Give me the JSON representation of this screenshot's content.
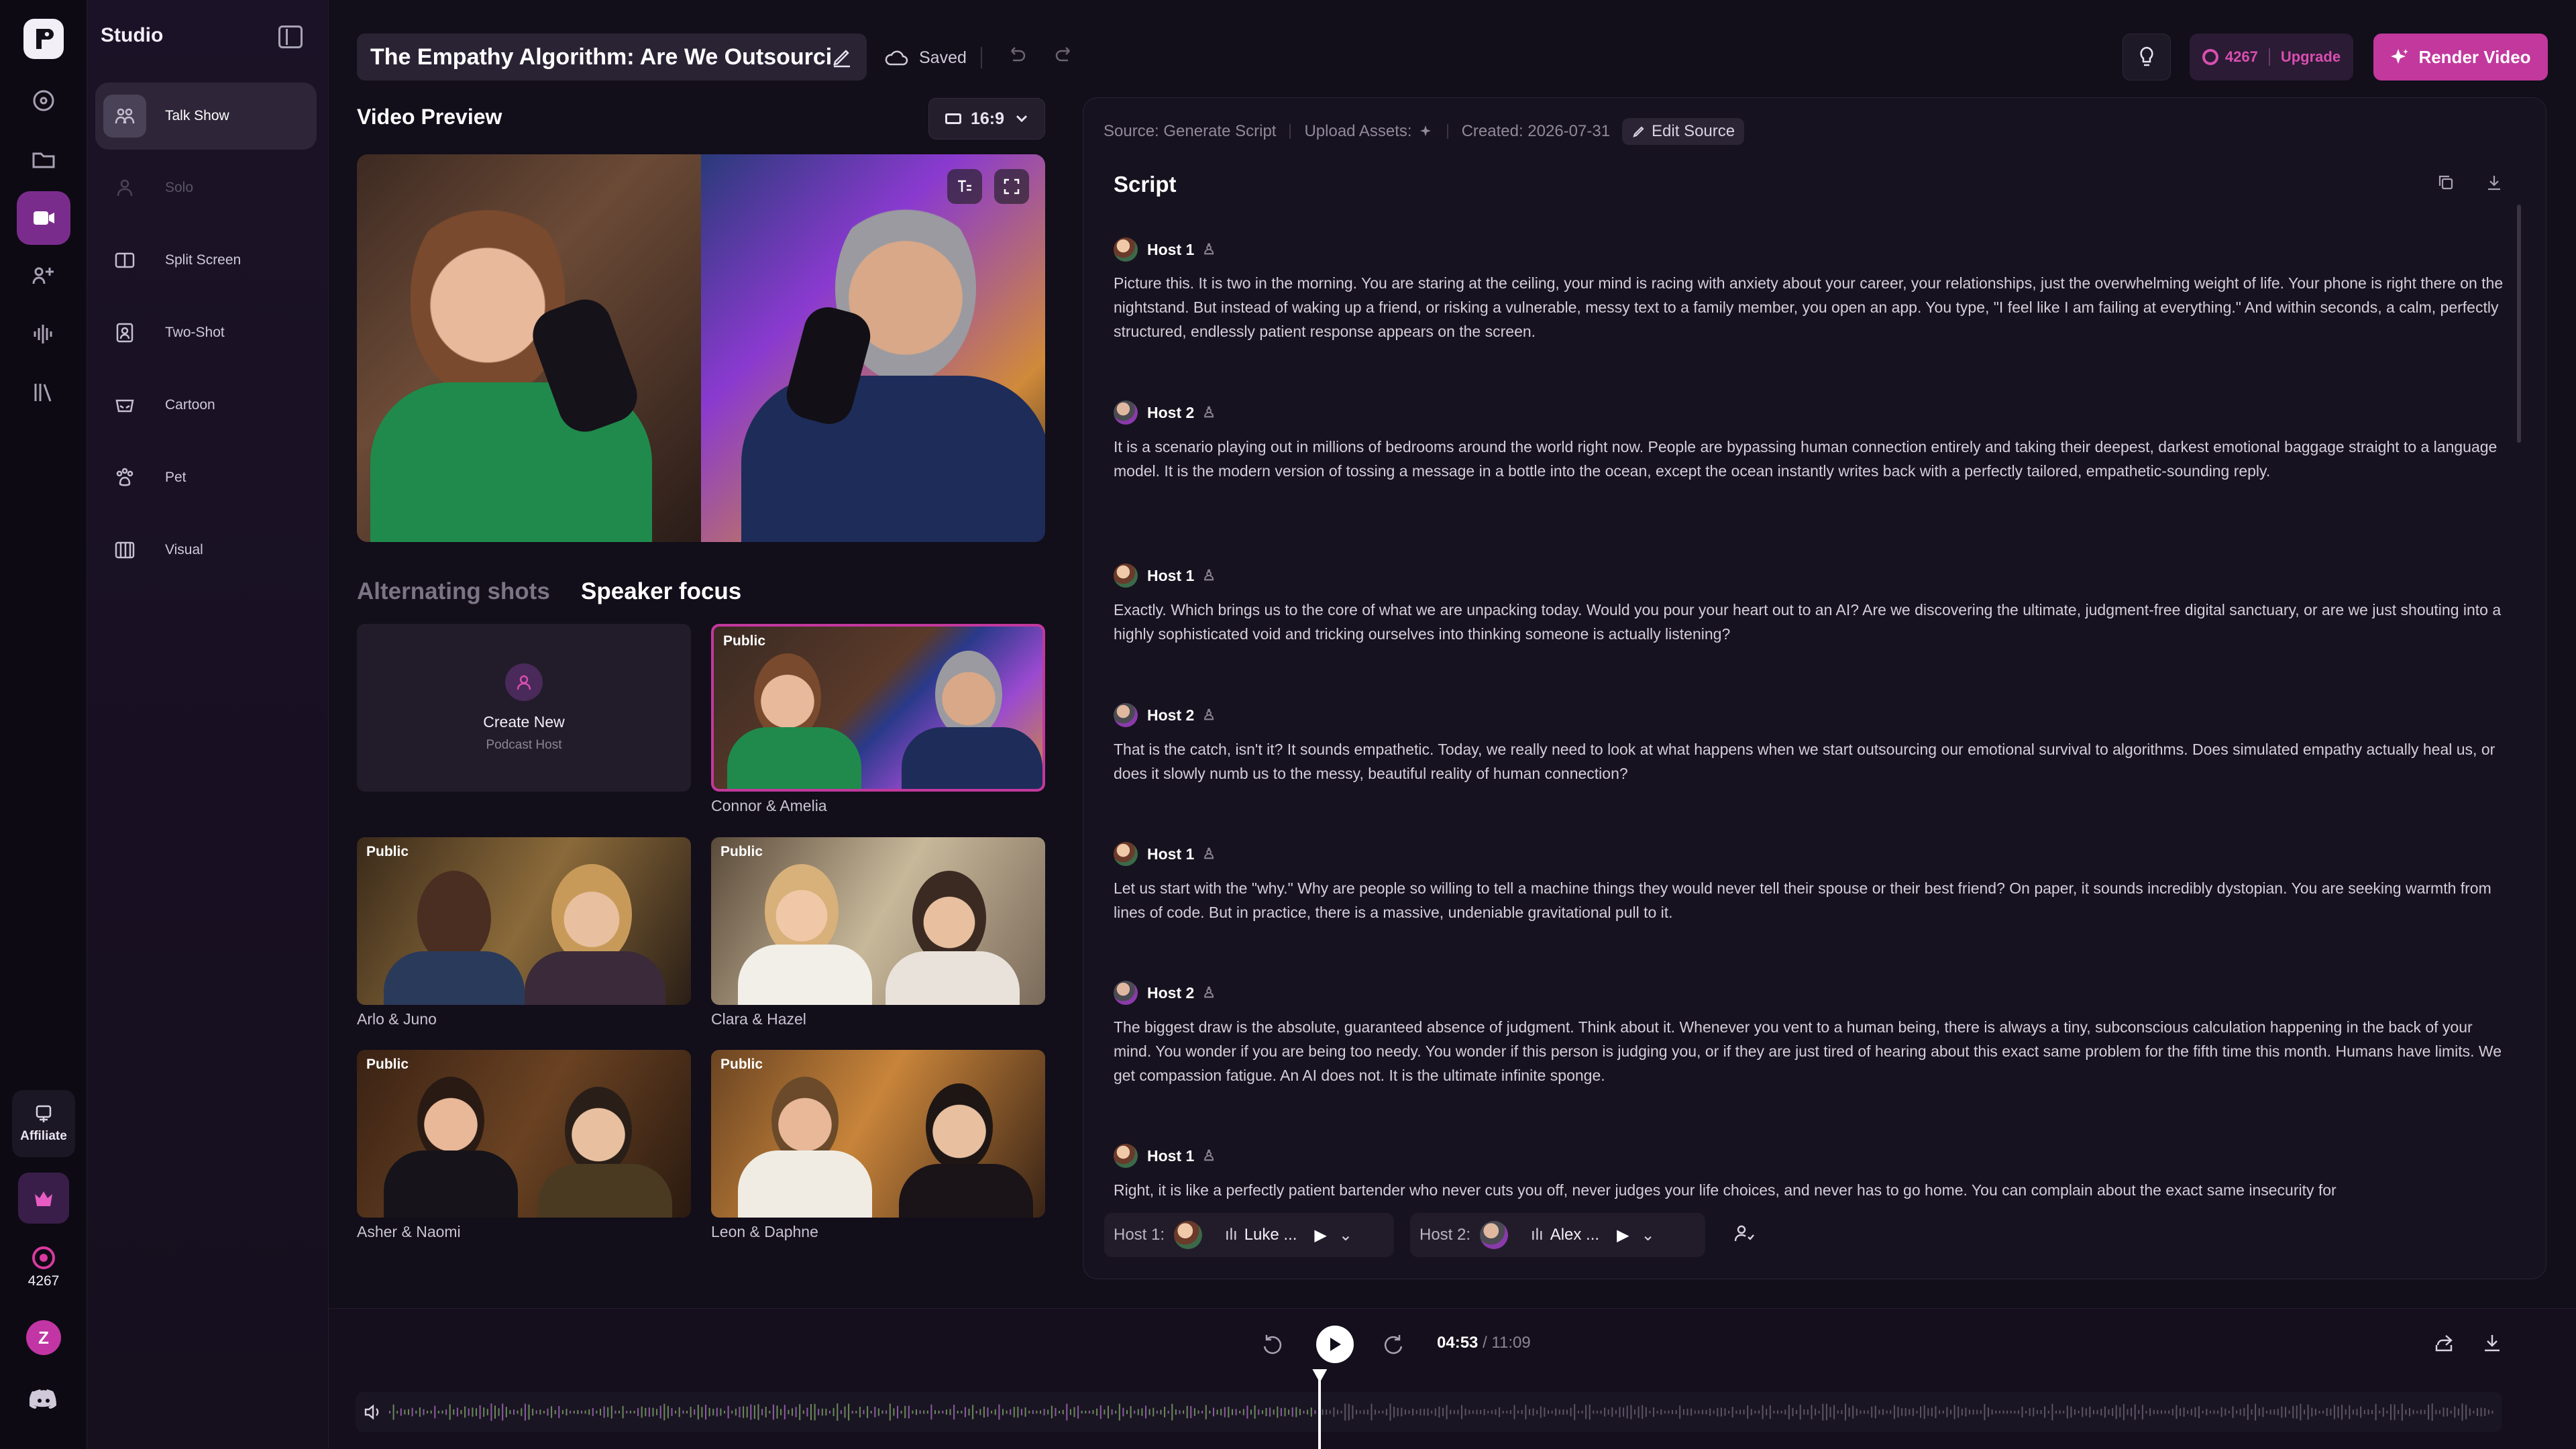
{
  "app": {
    "studio_label": "Studio",
    "credits": "4267",
    "avatar_letter": "Z",
    "affiliate_label": "Affiliate"
  },
  "sidebar": {
    "items": [
      {
        "label": "Talk Show",
        "active": true,
        "icon": "talk-show-icon"
      },
      {
        "label": "Solo",
        "disabled": true,
        "icon": "solo-icon"
      },
      {
        "label": "Split Screen",
        "icon": "split-screen-icon"
      },
      {
        "label": "Two-Shot",
        "icon": "two-shot-icon"
      },
      {
        "label": "Cartoon",
        "icon": "cartoon-icon"
      },
      {
        "label": "Pet",
        "icon": "paw-icon"
      },
      {
        "label": "Visual",
        "icon": "visual-icon"
      }
    ]
  },
  "header": {
    "title": "The Empathy Algorithm: Are We Outsourci...",
    "saved": "Saved",
    "credits": "4267",
    "upgrade": "Upgrade",
    "render": "Render Video"
  },
  "preview": {
    "heading": "Video Preview",
    "ratio": "16:9"
  },
  "shots": {
    "tab_alternating": "Alternating shots",
    "tab_speaker": "Speaker focus"
  },
  "hosts": {
    "create_title": "Create New",
    "create_sub": "Podcast Host",
    "public": "Public",
    "items": [
      {
        "name": "Connor & Amelia",
        "selected": true
      },
      {
        "name": "Arlo & Juno"
      },
      {
        "name": "Clara & Hazel"
      },
      {
        "name": "Asher & Naomi"
      },
      {
        "name": "Leon & Daphne"
      }
    ]
  },
  "meta": {
    "source": "Source: Generate Script",
    "upload": "Upload Assets:",
    "created": "Created: 2026-07-31",
    "edit": "Edit Source"
  },
  "script": {
    "heading": "Script",
    "blocks": [
      {
        "host": "Host 1",
        "text": "Picture this. It is two in the morning. You are staring at the ceiling, your mind is racing with anxiety about your career, your relationships, just the overwhelming weight of life. Your phone is right there on the nightstand. But instead of waking up a friend, or risking a vulnerable, messy text to a family member, you open an app. You type, \"I feel like I am failing at everything.\" And within seconds, a calm, perfectly structured, endlessly patient response appears on the screen."
      },
      {
        "host": "Host 2",
        "text": "It is a scenario playing out in millions of bedrooms around the world right now. People are bypassing human connection entirely and taking their deepest, darkest emotional baggage straight to a language model. It is the modern version of tossing a message in a bottle into the ocean, except the ocean instantly writes back with a perfectly tailored, empathetic-sounding reply."
      },
      {
        "host": "Host 1",
        "text": "Exactly. Which brings us to the core of what we are unpacking today. Would you pour your heart out to an AI? Are we discovering the ultimate, judgment-free digital sanctuary, or are we just shouting into a highly sophisticated void and tricking ourselves into thinking someone is actually listening?"
      },
      {
        "host": "Host 2",
        "text": "That is the catch, isn't it? It sounds empathetic. Today, we really need to look at what happens when we start outsourcing our emotional survival to algorithms. Does simulated empathy actually heal us, or does it slowly numb us to the messy, beautiful reality of human connection?"
      },
      {
        "host": "Host 1",
        "text": "Let us start with the \"why.\" Why are people so willing to tell a machine things they would never tell their spouse or their best friend? On paper, it sounds incredibly dystopian. You are seeking warmth from lines of code. But in practice, there is a massive, undeniable gravitational pull to it."
      },
      {
        "host": "Host 2",
        "text": "The biggest draw is the absolute, guaranteed absence of judgment. Think about it. Whenever you vent to a human being, there is always a tiny, subconscious calculation happening in the back of your mind. You wonder if you are being too needy. You wonder if this person is judging you, or if they are just tired of hearing about this exact same problem for the fifth time this month. Humans have limits. We get compassion fatigue. An AI does not. It is the ultimate infinite sponge."
      },
      {
        "host": "Host 1",
        "text": "Right, it is like a perfectly patient bartender who never cuts you off, never judges your life choices, and never has to go home. You can complain about the exact same insecurity for"
      }
    ]
  },
  "voices": {
    "host1_label": "Host 1:",
    "host1_voice": "Luke ...",
    "host2_label": "Host 2:",
    "host2_voice": "Alex ..."
  },
  "player": {
    "current": "04:53",
    "total": "/ 11:09",
    "progress": 0.4412
  },
  "colors": {
    "accent": "#c2389d",
    "accent_soft": "#7a2c8c",
    "bg": "#120e1a"
  }
}
